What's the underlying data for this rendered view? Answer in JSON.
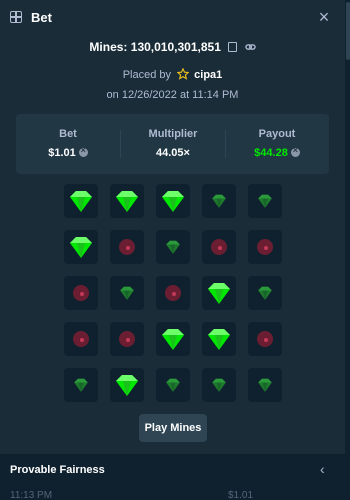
{
  "header": {
    "title": "Bet",
    "close_icon": "close-icon"
  },
  "mines": {
    "prefix": "Mines:",
    "id": "130,010,301,851"
  },
  "placed": {
    "text": "Placed by",
    "username": "cipa1",
    "date": "on 12/26/2022 at 11:14 PM"
  },
  "stats": {
    "bet": {
      "label": "Bet",
      "value": "$1.01"
    },
    "multiplier": {
      "label": "Multiplier",
      "value": "44.05×"
    },
    "payout": {
      "label": "Payout",
      "value": "$44.28"
    }
  },
  "grid": {
    "rows": 5,
    "cols": 5,
    "tiles": [
      "gem-revealed",
      "gem-revealed",
      "gem-revealed",
      "gem",
      "gem",
      "gem-revealed",
      "mine",
      "gem",
      "mine",
      "mine",
      "mine",
      "gem",
      "mine",
      "gem-revealed",
      "gem",
      "mine",
      "mine",
      "gem-revealed",
      "gem-revealed",
      "mine",
      "gem",
      "gem-revealed",
      "gem",
      "gem",
      "gem"
    ]
  },
  "play_button": {
    "label": "Play Mines"
  },
  "fairness": {
    "label": "Provable Fairness"
  },
  "peek_row": {
    "time": "11:13 PM",
    "amount": "$1.01"
  },
  "colors": {
    "background": "#1a2c38",
    "panel": "#213743",
    "tile": "#0f212e",
    "gem_bright": "#00e701",
    "gem_dim": "#1f7a2e",
    "mine": "#6b1e32",
    "text_muted": "#b1bad3",
    "payout": "#00e701"
  }
}
